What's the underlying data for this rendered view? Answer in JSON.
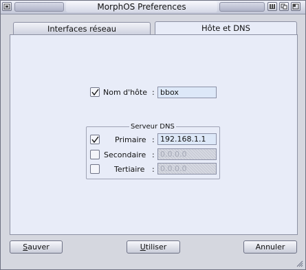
{
  "window": {
    "title": "MorphOS Preferences",
    "icons": [
      "iconify-icon",
      "depth-icon",
      "zoom-icon"
    ]
  },
  "tabs": [
    {
      "label": "Interfaces réseau",
      "active": false
    },
    {
      "label": "Hôte et DNS",
      "active": true
    }
  ],
  "hostname": {
    "checked": true,
    "label": "Nom d'hôte",
    "colon": ":",
    "value": "bbox"
  },
  "dns": {
    "group_title": "Serveur DNS",
    "servers": [
      {
        "checked": true,
        "label": "Primaire",
        "value": "192.168.1.1",
        "enabled": true
      },
      {
        "checked": false,
        "label": "Secondaire",
        "value": "0.0.0.0",
        "enabled": false
      },
      {
        "checked": false,
        "label": "Tertiaire",
        "value": "0.0.0.0",
        "enabled": false
      }
    ]
  },
  "buttons": {
    "save": {
      "first": "S",
      "rest": "auver"
    },
    "use": {
      "first": "U",
      "rest": "tiliser"
    },
    "cancel": {
      "label": "Annuler"
    }
  },
  "colors": {
    "panel": "#e8ecf8",
    "input": "#dde8f8",
    "frame": "#d5d7df"
  }
}
